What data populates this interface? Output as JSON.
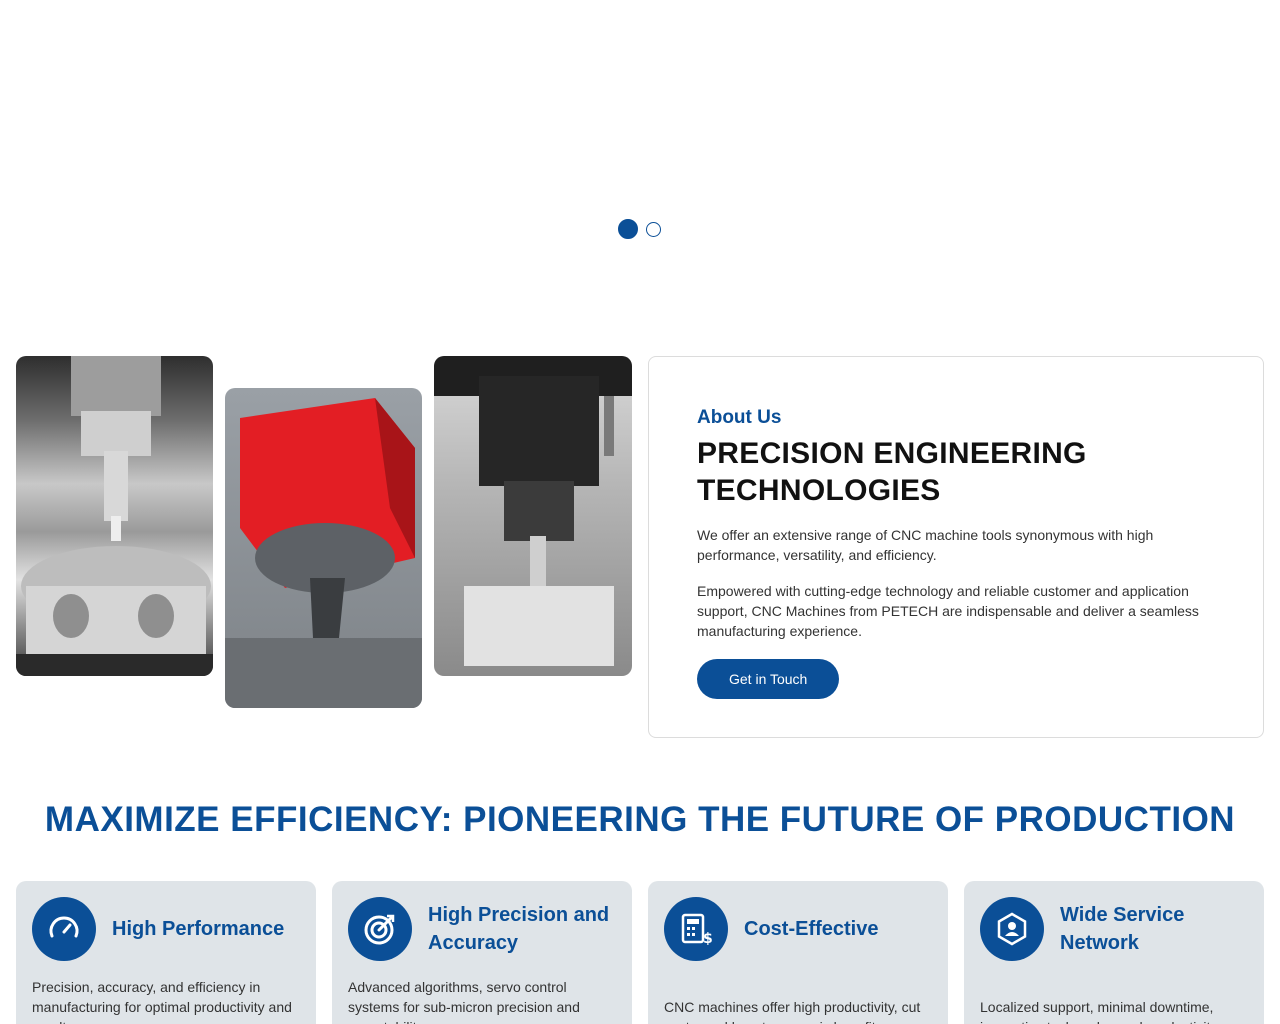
{
  "carousel": {
    "slide_count": 2,
    "active_slide": 1
  },
  "about": {
    "kicker": "About Us",
    "title_line1": "PRECISION ENGINEERING",
    "title_line2": "TECHNOLOGIES",
    "paragraph1": "We offer an extensive range of CNC machine tools synonymous with high performance, versatility, and efficiency.",
    "paragraph2": "Empowered with cutting-edge technology and reliable customer and application support, CNC Machines from PETECH are indispensable and deliver a seamless manufacturing experience.",
    "cta_label": "Get in Touch"
  },
  "headline": "MAXIMIZE EFFICIENCY: PIONEERING THE FUTURE OF PRODUCTION",
  "features": [
    {
      "icon": "speedometer-icon",
      "title": "High Performance",
      "desc": "Precision, accuracy, and efficiency in manufacturing for optimal productivity and results."
    },
    {
      "icon": "target-icon",
      "title": "High Precision and Accuracy",
      "desc": "Advanced algorithms, servo control systems for sub-micron precision and repeatability."
    },
    {
      "icon": "calculator-dollar-icon",
      "title": "Cost-Effective",
      "desc": "CNC machines offer high productivity, cut costs, and boost economic benefits."
    },
    {
      "icon": "support-network-icon",
      "title": "Wide Service Network",
      "desc": "Localized support, minimal downtime, innovative tech, enhanced productivity."
    }
  ],
  "colors": {
    "accent": "#0b4f97",
    "card_bg": "#dfe4e8"
  }
}
